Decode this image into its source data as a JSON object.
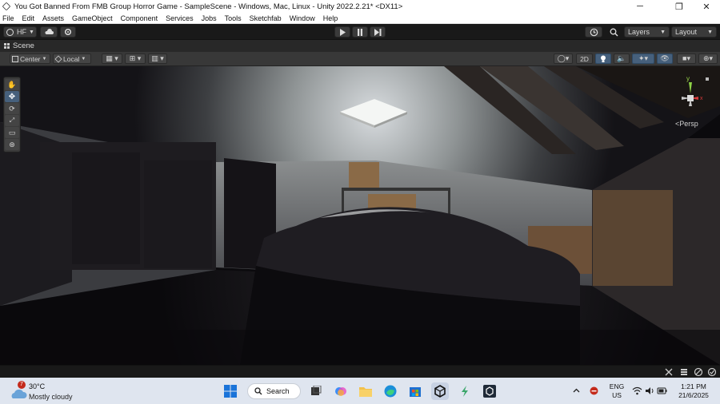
{
  "window": {
    "title": "You Got Banned From FMB Group Horror Game - SampleScene - Windows, Mac, Linux - Unity 2022.2.21* <DX11>",
    "controls": [
      "─",
      "❐",
      "✕"
    ]
  },
  "menu": [
    "File",
    "Edit",
    "Assets",
    "GameObject",
    "Component",
    "Services",
    "Jobs",
    "Tools",
    "Sketchfab",
    "Window",
    "Help"
  ],
  "toolbar": {
    "account_label": "HF",
    "layers_label": "Layers",
    "layout_label": "Layout"
  },
  "scene_tab": {
    "label": "Scene"
  },
  "scene_toolbar": {
    "pivot_mode": "Center",
    "pivot_space": "Local",
    "mode_2d": "2D"
  },
  "viewport": {
    "projection_label": "Persp",
    "gizmo_axes": {
      "x": "x",
      "y": "y"
    }
  },
  "taskbar": {
    "weather": {
      "temp": "30°C",
      "condition": "Mostly cloudy",
      "badge": "7"
    },
    "search_label": "Search",
    "language": {
      "line1": "ENG",
      "line2": "US"
    },
    "clock": {
      "time": "1:21 PM",
      "date": "21/6/2025"
    }
  },
  "colors": {
    "editor_dark": "#191919",
    "toolbar_gray": "#383838",
    "active_blue": "#46607c",
    "taskbar_bg": "#dfe5ef"
  }
}
